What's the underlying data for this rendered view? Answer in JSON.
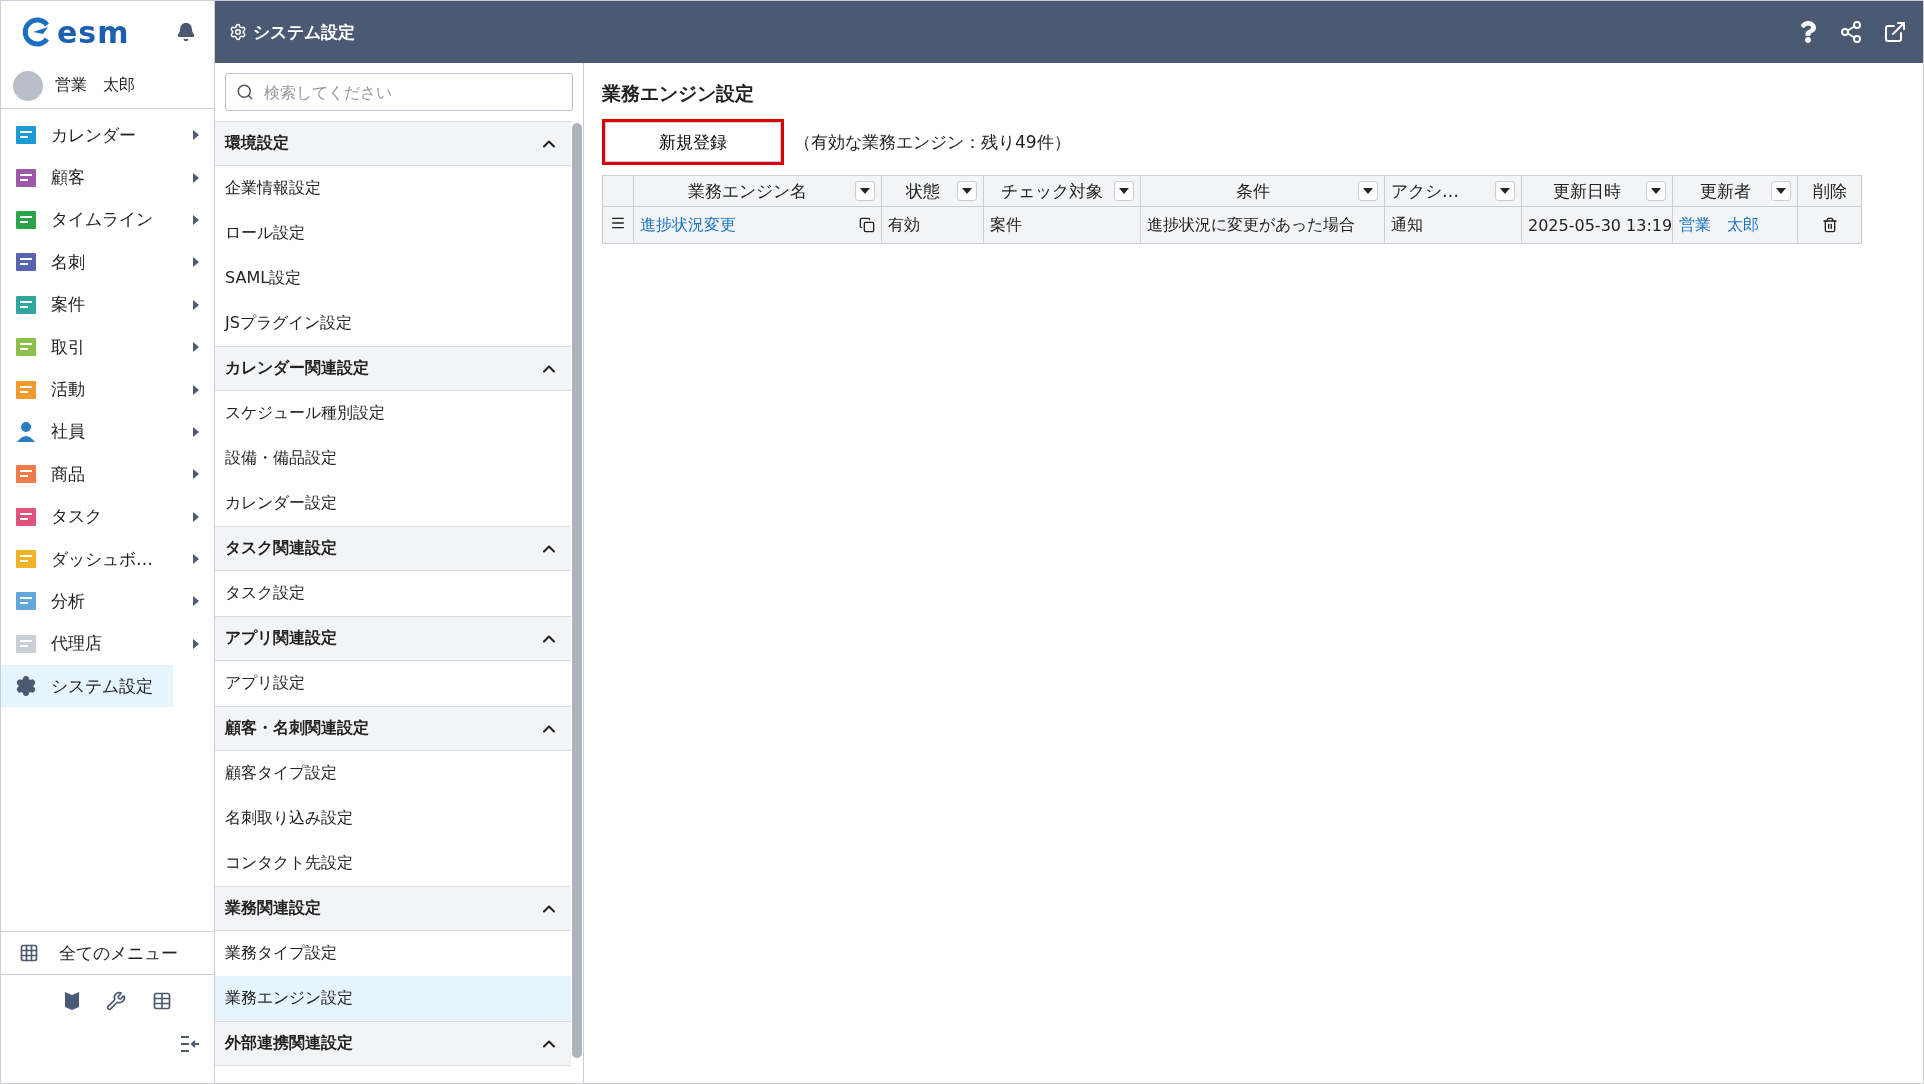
{
  "sidebar": {
    "logo": "esm",
    "user": "営業　太郎",
    "menu": [
      {
        "label": "カレンダー",
        "selected": false
      },
      {
        "label": "顧客",
        "selected": false
      },
      {
        "label": "タイムライン",
        "selected": false
      },
      {
        "label": "名刺",
        "selected": false
      },
      {
        "label": "案件",
        "selected": false
      },
      {
        "label": "取引",
        "selected": false
      },
      {
        "label": "活動",
        "selected": false
      },
      {
        "label": "社員",
        "selected": false
      },
      {
        "label": "商品",
        "selected": false
      },
      {
        "label": "タスク",
        "selected": false
      },
      {
        "label": "ダッシュボ…",
        "selected": false
      },
      {
        "label": "分析",
        "selected": false
      },
      {
        "label": "代理店",
        "selected": false
      },
      {
        "label": "システム設定",
        "selected": true
      }
    ],
    "all_menu": "全てのメニュー"
  },
  "header": {
    "title": "システム設定"
  },
  "settings_panel": {
    "search": {
      "placeholder": "検索してください"
    },
    "groups": [
      {
        "title": "環境設定",
        "expanded": true,
        "items": [
          {
            "label": "企業情報設定",
            "selected": false
          },
          {
            "label": "ロール設定",
            "selected": false
          },
          {
            "label": "SAML設定",
            "selected": false
          },
          {
            "label": "JSプラグイン設定",
            "selected": false
          }
        ]
      },
      {
        "title": "カレンダー関連設定",
        "expanded": true,
        "items": [
          {
            "label": "スケジュール種別設定",
            "selected": false
          },
          {
            "label": "設備・備品設定",
            "selected": false
          },
          {
            "label": "カレンダー設定",
            "selected": false
          }
        ]
      },
      {
        "title": "タスク関連設定",
        "expanded": true,
        "items": [
          {
            "label": "タスク設定",
            "selected": false
          }
        ]
      },
      {
        "title": "アプリ関連設定",
        "expanded": true,
        "items": [
          {
            "label": "アプリ設定",
            "selected": false
          }
        ]
      },
      {
        "title": "顧客・名刺関連設定",
        "expanded": true,
        "items": [
          {
            "label": "顧客タイプ設定",
            "selected": false
          },
          {
            "label": "名刺取り込み設定",
            "selected": false
          },
          {
            "label": "コンタクト先設定",
            "selected": false
          }
        ]
      },
      {
        "title": "業務関連設定",
        "expanded": true,
        "items": [
          {
            "label": "業務タイプ設定",
            "selected": false
          },
          {
            "label": "業務エンジン設定",
            "selected": true
          }
        ]
      },
      {
        "title": "外部連携関連設定",
        "expanded": true
      }
    ]
  },
  "content": {
    "title": "業務エンジン設定",
    "new_button": "新規登録",
    "quota": "（有効な業務エンジン：残り49件）",
    "table": {
      "columns": [
        {
          "label": "業務エンジン名",
          "filter": true
        },
        {
          "label": "状態",
          "filter": true
        },
        {
          "label": "チェック対象",
          "filter": true
        },
        {
          "label": "条件",
          "filter": true
        },
        {
          "label": "アクシ…",
          "filter": true
        },
        {
          "label": "更新日時",
          "filter": true
        },
        {
          "label": "更新者",
          "filter": true
        },
        {
          "label": "削除",
          "filter": false
        }
      ],
      "rows": [
        {
          "name": "進捗状況変更",
          "status": "有効",
          "target": "案件",
          "condition": "進捗状況に変更があった場合",
          "action": "通知",
          "updated_at": "2025-05-30 13:19",
          "updated_by": "営業　太郎"
        }
      ]
    }
  }
}
